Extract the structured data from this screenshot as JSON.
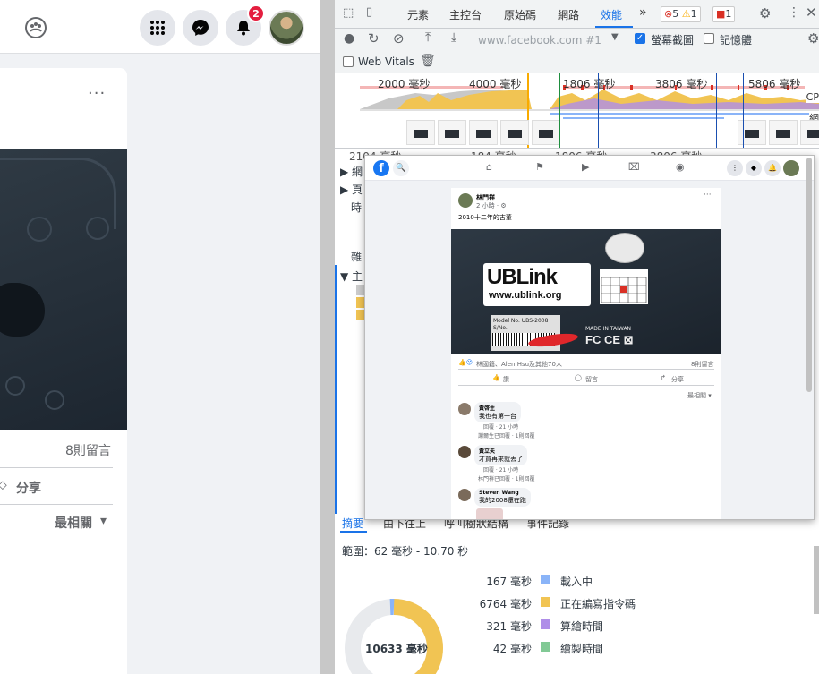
{
  "facebook": {
    "notification_count": "2",
    "comment_count": "8則留言",
    "share_label": "分享",
    "sort_label": "最相關",
    "more_dots": "···"
  },
  "devtools": {
    "tabs": [
      {
        "label": "元素"
      },
      {
        "label": "主控台"
      },
      {
        "label": "原始碼"
      },
      {
        "label": "網路"
      },
      {
        "label": "效能"
      }
    ],
    "more_tabs": "»",
    "errors": "5",
    "warnings": "1",
    "issues": "1",
    "url": "www.facebook.com #1",
    "screenshots_label": "螢幕截圖",
    "memory_label": "記憶體",
    "web_vitals_label": "Web Vitals",
    "timeline": {
      "ruler_top": [
        "2000 毫秒",
        "4000 毫秒",
        "1806 毫秒",
        "3806 毫秒",
        "5806 毫秒"
      ],
      "ruler_bottom": [
        "2104 毫秒",
        "184 毫秒",
        "1806 毫秒",
        "3806 毫秒"
      ],
      "cpu_label": "CP",
      "net_label": "網"
    },
    "tree": {
      "rows": [
        {
          "label": "▶ 網"
        },
        {
          "label": "▶ 頁"
        },
        {
          "label": "時"
        },
        {
          "label": "雜"
        },
        {
          "label": "▼ 主"
        }
      ]
    },
    "bottom_tabs": [
      {
        "label": "摘要"
      },
      {
        "label": "由下往上"
      },
      {
        "label": "呼叫樹狀結構"
      },
      {
        "label": "事件記錄"
      }
    ],
    "range": "範圍：62 毫秒 - 10.70 秒",
    "summary": [
      {
        "value": "167 毫秒",
        "label": "載入中",
        "color": "#8ab4f8"
      },
      {
        "value": "6764 毫秒",
        "label": "正在編寫指令碼",
        "color": "#f1c453"
      },
      {
        "value": "321 毫秒",
        "label": "算繪時間",
        "color": "#af8ee8"
      },
      {
        "value": "42 毫秒",
        "label": "繪製時間",
        "color": "#81c995"
      }
    ],
    "total": "10633 毫秒"
  },
  "popup": {
    "poster_name": "林門祥",
    "post_time": "2 小時 · ⚙",
    "post_text": "2010十二年的古董",
    "ublink_title": "UBLink",
    "ublink_url": "www.ublink.org",
    "model_line1": "Model No. UBS-2008",
    "model_line2": "S/No.",
    "made_in": "MADE IN TAIWAN",
    "fcc": "FC CE ⊠",
    "reactions": "林國籍、Alen Hsu及其他70人",
    "comments_count": "8則留言",
    "like_label": "讚",
    "comment_label": "留言",
    "share_label": "分享",
    "sort_label": "最相關 ▾",
    "comments": [
      {
        "name": "黃啓生",
        "text": "我也有第一台",
        "meta": "回覆 · 21 小時"
      },
      {
        "name": "黃立夫",
        "text": "才買再來就丟了",
        "meta": "回覆 · 21 小時"
      },
      {
        "name": "Steven Wang",
        "text": "我的2008還在跑",
        "meta": ""
      }
    ],
    "replies": [
      {
        "text": "謝爾生已回覆 · 1則回覆"
      },
      {
        "text": "林門祥已回覆 · 1則回覆"
      }
    ]
  }
}
